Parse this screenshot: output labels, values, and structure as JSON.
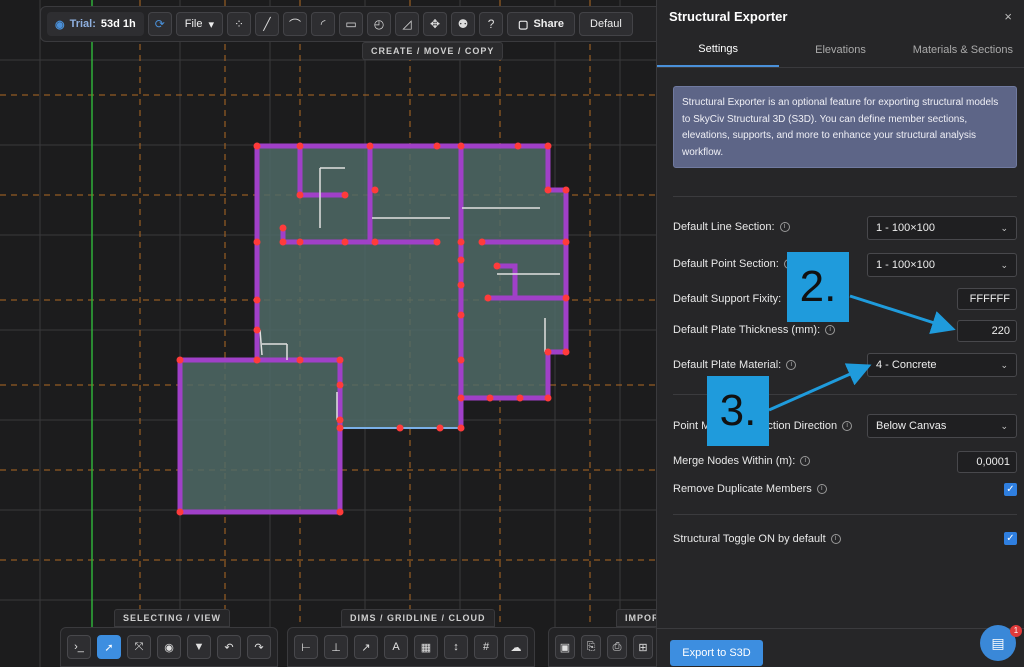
{
  "toolbar": {
    "trial_label": "Trial:",
    "trial_value": "53d 1h",
    "file_label": "File",
    "share_label": "Share",
    "default_label": "Defaul",
    "create_tooltip": "CREATE / MOVE / COPY"
  },
  "bottom": {
    "selecting_label": "SELECTING / VIEW",
    "dims_label": "DIMS / GRIDLINE / CLOUD",
    "import_label": "IMPOR"
  },
  "panel": {
    "title": "Structural Exporter",
    "close": "×",
    "tabs": [
      "Settings",
      "Elevations",
      "Materials & Sections"
    ],
    "info": "Structural Exporter is an optional feature for exporting structural models to SkyCiv Structural 3D (S3D). You can define member sections, elevations, supports, and more to enhance your structural analysis workflow.",
    "fields": {
      "line_section_label": "Default Line Section:",
      "line_section_value": "1 - 100×100",
      "point_section_label": "Default Point Section:",
      "point_section_value": "1 - 100×100",
      "support_fixity_label": "Default Support Fixity:",
      "support_fixity_value": "FFFFFF",
      "plate_thickness_label": "Default Plate Thickness (mm):",
      "plate_thickness_value": "220",
      "plate_material_label": "Default Plate Material:",
      "plate_material_value": "4 - Concrete",
      "projection_label": "Point M",
      "projection_label_tail": "ection Direction",
      "projection_value": "Below Canvas",
      "merge_label": "Merge Nodes Within (m):",
      "merge_value": "0,0001",
      "remove_dup_label": "Remove Duplicate Members",
      "remove_dup_checked": true,
      "toggle_label": "Structural Toggle ON by default",
      "toggle_checked": true
    },
    "export_button": "Export to S3D",
    "chat_badge": "1"
  },
  "annotations": {
    "callout_2": "2.",
    "callout_3": "3."
  },
  "colors": {
    "accent": "#3d8ee0",
    "callout": "#1f9bdc",
    "wall": "#a040c8",
    "node": "#ff3b3b",
    "slab": "#4f6a66",
    "grid_orange": "#b06a22",
    "grid_green": "#2fae3a"
  }
}
